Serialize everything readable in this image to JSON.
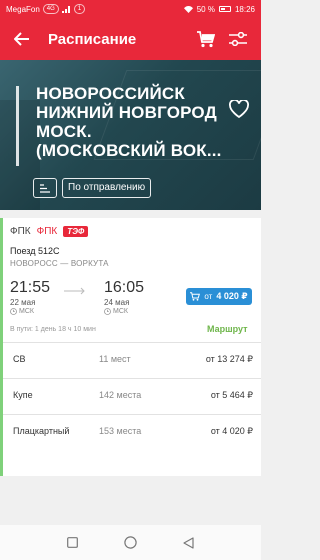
{
  "status_bar": {
    "carrier": "MegaFon",
    "net": "4G",
    "badge": "1",
    "battery": "50 %",
    "time": "18:26"
  },
  "app_bar": {
    "title": "Расписание",
    "icons": [
      "back-arrow-icon",
      "cart-icon",
      "filter-sliders-icon"
    ]
  },
  "hero": {
    "route": "НОВОРОССИЙСК НИЖНИЙ НОВГОРОД МОСК. (МОСКОВСКИЙ ВОК...",
    "filter_label": "По отправлению"
  },
  "train_card": {
    "carriers": [
      "ФПК",
      "ФПК",
      "ТЭФ"
    ],
    "train_number": "Поезд 512С",
    "relation": "НОВОРОСС — ВОРКУТА",
    "departure": {
      "time": "21:55",
      "date": "22 мая",
      "tz": "МСК"
    },
    "arrival": {
      "time": "16:05",
      "date": "24 мая",
      "tz": "МСК"
    },
    "price_button": {
      "prefix": "от",
      "price": "4 020 ₽"
    },
    "travel_time": "В пути: 1 день 18 ч 10 мин",
    "route_link": "Маршрут",
    "seat_classes": [
      {
        "class": "СВ",
        "seats": "11 мест",
        "price": "от 13 274 ₽"
      },
      {
        "class": "Купе",
        "seats": "142 места",
        "price": "от 5 464 ₽"
      },
      {
        "class": "Плацкартный",
        "seats": "153 места",
        "price": "от 4 020 ₽"
      }
    ]
  },
  "colors": {
    "brand_red": "#e8283a",
    "price_blue": "#2a8fd6",
    "route_green": "#6fb64b",
    "accent_green": "#7fd17a"
  }
}
